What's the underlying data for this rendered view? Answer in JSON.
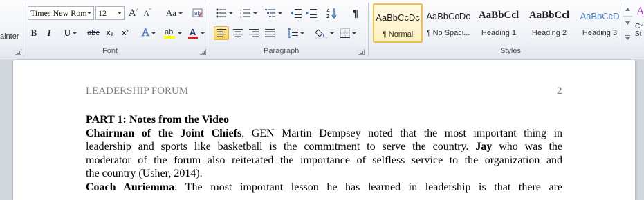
{
  "ribbon": {
    "clipboard": {
      "painter_label": "ainter"
    },
    "font": {
      "group_label": "Font",
      "family": "Times New Rom",
      "size": "12",
      "grow_label": "A",
      "shrink_label": "A",
      "change_case_label": "Aa",
      "bold_label": "B",
      "italic_label": "I",
      "underline_label": "U",
      "strike_label": "abc",
      "subscript_label": "x₂",
      "superscript_label": "x²",
      "effects_label": "A",
      "font_color_label": "A",
      "colors": {
        "highlight": "#ffff00",
        "font_color": "#e31b1b"
      }
    },
    "paragraph": {
      "group_label": "Paragraph",
      "pilcrow": "¶"
    },
    "styles": {
      "group_label": "Styles",
      "items": [
        {
          "sample": "AaBbCcDc",
          "name": "¶ Normal"
        },
        {
          "sample": "AaBbCcDc",
          "name": "¶ No Spaci..."
        },
        {
          "sample": "AaBbCcl",
          "name": "Heading 1"
        },
        {
          "sample": "AaBbCcl",
          "name": "Heading 2"
        },
        {
          "sample": "AaBbCcD",
          "name": "Heading 3"
        }
      ],
      "change_styles_labels": [
        "Ch",
        "St"
      ],
      "heading3_color": "#4f81bd"
    }
  },
  "document": {
    "header_left": "LEADERSHIP FORUM",
    "header_right": "2",
    "part_heading": "PART 1: Notes from the Video",
    "p1": {
      "bold_lead": "Chairman of the Joint Chiefs",
      "l1_rest": ", GEN Martin Dempsey noted that the most important thing in",
      "l2_pre": "leadership and sports like basketball is the commitment to serve the country. ",
      "l2_bold": "Jay",
      "l2_post": " who was the",
      "l3": "moderator of the forum also reiterated the importance of selfless service to the organization and",
      "l4": "the country (Usher, 2014)."
    },
    "p2": {
      "bold_lead": "Coach Auriemma",
      "l1_rest": ": The most important lesson he has learned in leadership is that there are"
    }
  }
}
